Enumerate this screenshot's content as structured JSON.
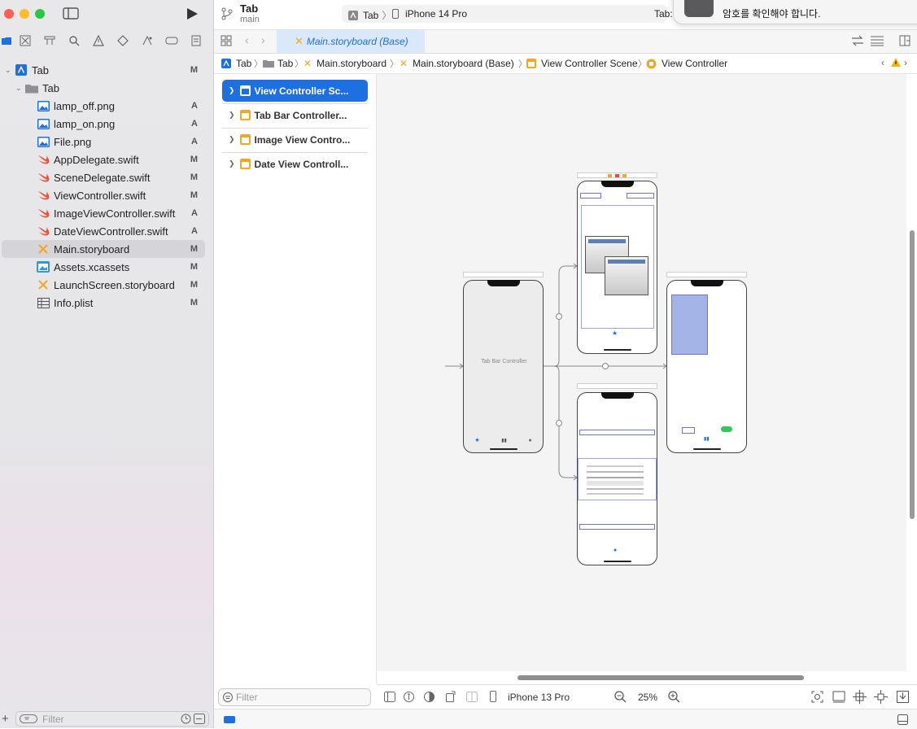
{
  "window": {
    "traffic_colors": [
      "#ff5f57",
      "#febc2e",
      "#28c840"
    ]
  },
  "toolbar": {
    "project_name": "Tab",
    "branch": "main",
    "scheme": "Tab",
    "destination": "iPhone 14 Pro",
    "status_prefix": "Tab:"
  },
  "notification": {
    "message": "암호를 확인해야 합니다."
  },
  "navigator": {
    "tree": [
      {
        "label": "Tab",
        "badge": "M",
        "icon": "project-icon",
        "indent": 0
      },
      {
        "label": "Tab",
        "badge": "",
        "icon": "folder-icon",
        "indent": 1
      },
      {
        "label": "lamp_off.png",
        "badge": "A",
        "icon": "image-file-icon",
        "indent": 2
      },
      {
        "label": "lamp_on.png",
        "badge": "A",
        "icon": "image-file-icon",
        "indent": 2
      },
      {
        "label": "File.png",
        "badge": "A",
        "icon": "image-file-icon",
        "indent": 2
      },
      {
        "label": "AppDelegate.swift",
        "badge": "M",
        "icon": "swift-file-icon",
        "indent": 2
      },
      {
        "label": "SceneDelegate.swift",
        "badge": "M",
        "icon": "swift-file-icon",
        "indent": 2
      },
      {
        "label": "ViewController.swift",
        "badge": "M",
        "icon": "swift-file-icon",
        "indent": 2
      },
      {
        "label": "ImageViewController.swift",
        "badge": "A",
        "icon": "swift-file-icon",
        "indent": 2
      },
      {
        "label": "DateViewController.swift",
        "badge": "A",
        "icon": "swift-file-icon",
        "indent": 2
      },
      {
        "label": "Main.storyboard",
        "badge": "M",
        "icon": "storyboard-file-icon",
        "indent": 2,
        "selected": true
      },
      {
        "label": "Assets.xcassets",
        "badge": "M",
        "icon": "assets-file-icon",
        "indent": 2
      },
      {
        "label": "LaunchScreen.storyboard",
        "badge": "M",
        "icon": "storyboard-file-icon",
        "indent": 2
      },
      {
        "label": "Info.plist",
        "badge": "M",
        "icon": "plist-file-icon",
        "indent": 2
      }
    ],
    "filter_placeholder": "Filter"
  },
  "editor": {
    "tab_label": "Main.storyboard (Base)",
    "breadcrumb": [
      "Tab",
      "Tab",
      "Main.storyboard",
      "Main.storyboard (Base)",
      "View Controller Scene",
      "View Controller"
    ]
  },
  "outline": {
    "scenes": [
      {
        "label": "View Controller Sc...",
        "selected": true
      },
      {
        "label": "Tab Bar Controller...",
        "selected": false
      },
      {
        "label": "Image View Contro...",
        "selected": false
      },
      {
        "label": "Date View Controll...",
        "selected": false
      }
    ],
    "filter_placeholder": "Filter"
  },
  "canvas": {
    "tab_bar_controller_label": "Tab Bar Controller"
  },
  "canvas_bottom": {
    "device": "iPhone 13 Pro",
    "zoom": "25%"
  },
  "colors": {
    "accent": "#1e6fe0",
    "swift": "#f05138",
    "storyboard": "#f5a623"
  }
}
